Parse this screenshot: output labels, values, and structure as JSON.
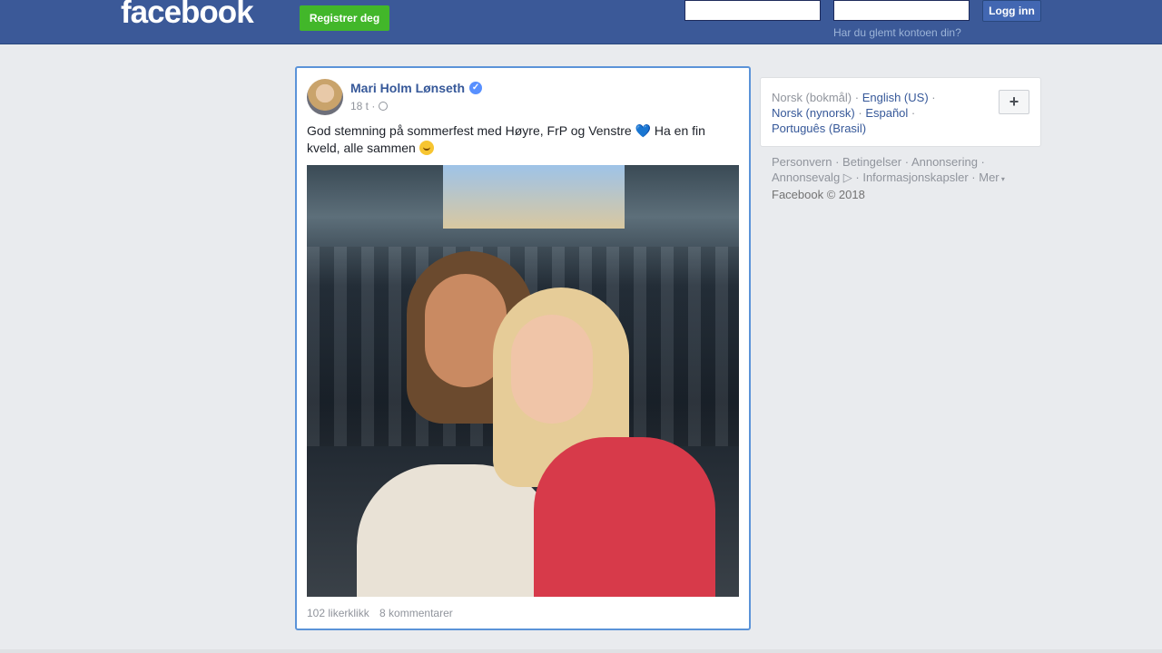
{
  "header": {
    "logo": "facebook",
    "register_label": "Registrer deg",
    "email_value": "",
    "password_value": "",
    "login_label": "Logg inn",
    "forgot_link": "Har du glemt kontoen din?",
    "colors": {
      "bar": "#3b5998",
      "register": "#42b72a",
      "login": "#4267b2"
    }
  },
  "post": {
    "author": "Mari Holm Lønseth",
    "verified": true,
    "time": "18 t ·",
    "text_part1": "God stemning på sommerfest med Høyre, FrP og Venstre",
    "heart": "💙",
    "text_part2": "Ha en fin kveld, alle sammen",
    "likes": "102 likerklikk",
    "comments": "8 kommentarer"
  },
  "sidebar": {
    "languages": {
      "current": "Norsk (bokmål)",
      "options": [
        "English (US)",
        "Norsk (nynorsk)",
        "Español",
        "Português (Brasil)"
      ],
      "add_label": "+"
    },
    "footer_links": [
      "Personvern",
      "Betingelser",
      "Annonsering",
      "Annonsevalg",
      "Informasjonskapsler",
      "Mer"
    ],
    "copyright": "Facebook © 2018"
  }
}
